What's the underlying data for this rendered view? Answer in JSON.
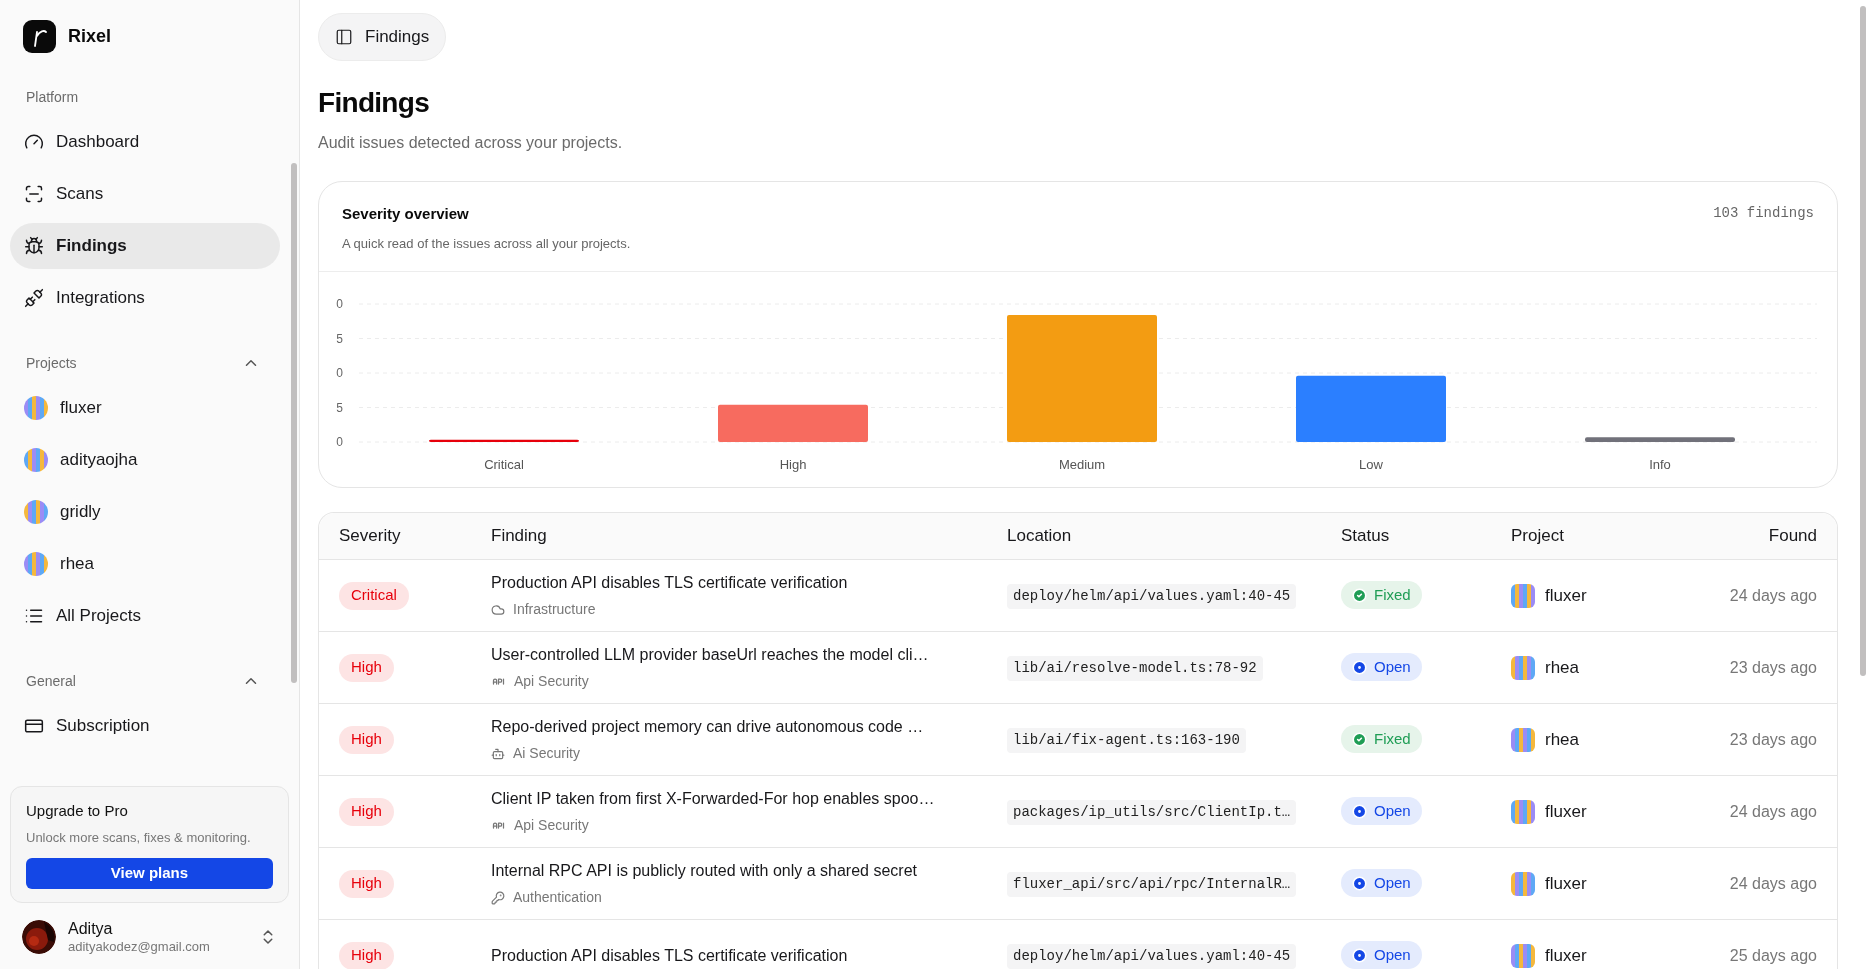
{
  "brand": {
    "name": "Rixel"
  },
  "sidebar": {
    "sections": [
      {
        "title": "Platform",
        "items": [
          {
            "label": "Dashboard",
            "kind": "gauge",
            "selected": false
          },
          {
            "label": "Scans",
            "kind": "scan",
            "selected": false
          },
          {
            "label": "Findings",
            "kind": "bug",
            "selected": true
          },
          {
            "label": "Integrations",
            "kind": "plug",
            "selected": false
          }
        ]
      },
      {
        "title": "Projects",
        "expanded": true,
        "items": [
          {
            "label": "fluxer",
            "kind": "project",
            "selected": false
          },
          {
            "label": "adityaojha",
            "kind": "project",
            "selected": false
          },
          {
            "label": "gridly",
            "kind": "project",
            "selected": false
          },
          {
            "label": "rhea",
            "kind": "project",
            "selected": false
          },
          {
            "label": "All Projects",
            "kind": "list",
            "selected": false
          }
        ]
      },
      {
        "title": "General",
        "expanded": true,
        "items": [
          {
            "label": "Subscription",
            "kind": "card",
            "selected": false
          }
        ]
      }
    ],
    "upgrade": {
      "title": "Upgrade to Pro",
      "text": "Unlock more scans, fixes & monitoring.",
      "button": "View plans"
    },
    "user": {
      "name": "Aditya",
      "email": "adityakodez@gmail.com"
    }
  },
  "header": {
    "breadcrumb": "Findings"
  },
  "page": {
    "title": "Findings",
    "subtitle": "Audit issues detected across your projects."
  },
  "overview": {
    "title": "Severity overview",
    "subtitle": "A quick read of the issues across all your projects.",
    "count": "103 findings",
    "bars": [
      {
        "label": "Critical",
        "color": "#e7000b"
      },
      {
        "label": "High",
        "color": "#f76b5f"
      },
      {
        "label": "Medium",
        "color": "#f39c12"
      },
      {
        "label": "Low",
        "color": "#2b7fff"
      },
      {
        "label": "Info",
        "color": "#71717a"
      }
    ],
    "axis_labels": [
      "0",
      "5",
      "0",
      "5",
      "0"
    ]
  },
  "table": {
    "columns": [
      "Severity",
      "Finding",
      "Location",
      "Status",
      "Project",
      "Found"
    ],
    "rows": [
      {
        "severity": "Critical",
        "finding": "Production API disables TLS certificate verification",
        "category": {
          "text": "Infrastructure",
          "kind": "cloud"
        },
        "location": "deploy/helm/api/values.yaml:40-45",
        "status": {
          "text": "Fixed",
          "kind": "fixed"
        },
        "project": "fluxer",
        "found": "24 days ago"
      },
      {
        "severity": "High",
        "finding": "User-controlled LLM provider baseUrl reaches the model cli…",
        "category": {
          "text": "Api Security",
          "kind": "api"
        },
        "location": "lib/ai/resolve-model.ts:78-92",
        "status": {
          "text": "Open",
          "kind": "open"
        },
        "project": "rhea",
        "found": "23 days ago"
      },
      {
        "severity": "High",
        "finding": "Repo-derived project memory can drive autonomous code …",
        "category": {
          "text": "Ai Security",
          "kind": "bot"
        },
        "location": "lib/ai/fix-agent.ts:163-190",
        "status": {
          "text": "Fixed",
          "kind": "fixed"
        },
        "project": "rhea",
        "found": "23 days ago"
      },
      {
        "severity": "High",
        "finding": "Client IP taken from first X-Forwarded-For hop enables spoo…",
        "category": {
          "text": "Api Security",
          "kind": "api"
        },
        "location": "packages/ip_utils/src/ClientIp.t…",
        "status": {
          "text": "Open",
          "kind": "open"
        },
        "project": "fluxer",
        "found": "24 days ago"
      },
      {
        "severity": "High",
        "finding": "Internal RPC API is publicly routed with only a shared secret",
        "category": {
          "text": "Authentication",
          "kind": "key"
        },
        "location": "fluxer_api/src/api/rpc/InternalR…",
        "status": {
          "text": "Open",
          "kind": "open"
        },
        "project": "fluxer",
        "found": "24 days ago"
      },
      {
        "severity": "High",
        "finding": "Production API disables TLS certificate verification",
        "location": "deploy/helm/api/values.yaml:40-45",
        "status": {
          "text": "Open",
          "kind": "open"
        },
        "project": "fluxer",
        "found": "25 days ago"
      }
    ]
  }
}
